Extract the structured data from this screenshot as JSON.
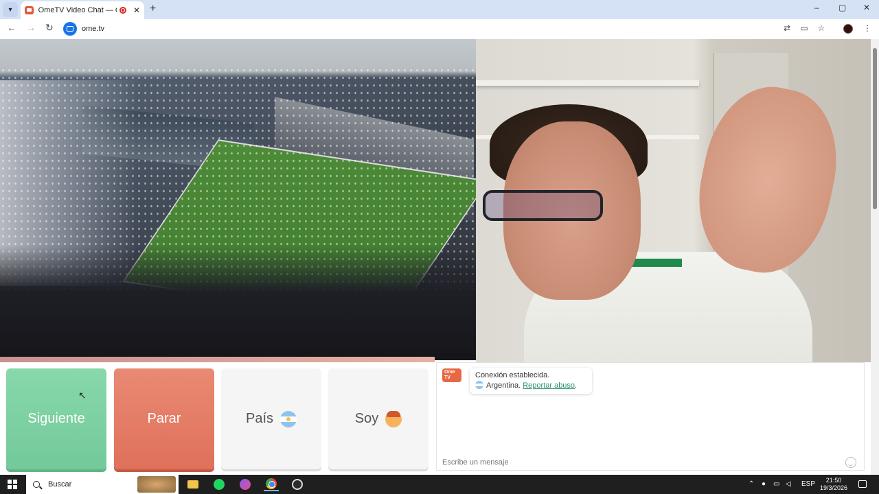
{
  "browser": {
    "tab_title": "OmeTV Video Chat — Ome",
    "tab_close": "✕",
    "new_tab": "+",
    "url": "ome.tv",
    "window_controls": {
      "minimize": "–",
      "maximize": "▢",
      "close": "✕"
    },
    "icons": [
      "back-icon",
      "forward-icon",
      "reload-icon",
      "site-info-icon",
      "translate-icon",
      "cast-icon",
      "bookmark-star-icon",
      "profile-avatar",
      "menu-icon"
    ]
  },
  "controls": {
    "next_label": "Siguiente",
    "stop_label": "Parar",
    "country_label": "País",
    "gender_label": "Soy"
  },
  "chat": {
    "logo_text": "Ome TV",
    "line1": "Conexión establecida.",
    "country": "Argentina.",
    "report_link": "Reportar abuso",
    "report_suffix": ".",
    "input_placeholder": "Escribe un mensaje"
  },
  "taskbar": {
    "search_label": "Buscar",
    "language": "ESP",
    "time": "21:50",
    "date": "19/3/2026"
  },
  "colors": {
    "next": "#7dd1a3",
    "stop": "#e47a63",
    "link": "#2b8f6b",
    "accent": "#1a73e8"
  }
}
